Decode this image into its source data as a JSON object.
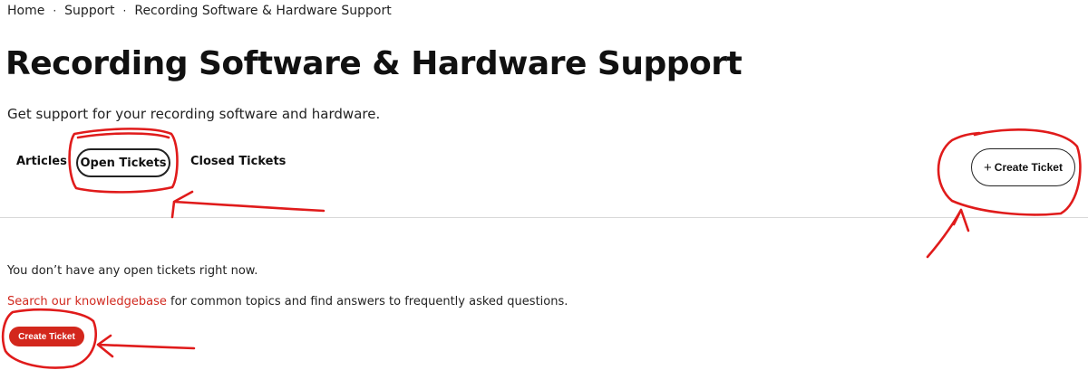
{
  "breadcrumb": {
    "items": [
      "Home",
      "Support",
      "Recording Software & Hardware Support"
    ],
    "separator": "·"
  },
  "page": {
    "title": "Recording Software & Hardware Support",
    "subtitle": "Get support for your recording software and hardware."
  },
  "tabs": [
    {
      "label": "Articles",
      "active": false
    },
    {
      "label": "Open Tickets",
      "active": true
    },
    {
      "label": "Closed Tickets",
      "active": false
    }
  ],
  "actions": {
    "create_ticket_top_label": "Create Ticket",
    "create_ticket_top_icon": "plus-icon",
    "create_ticket_bottom_label": "Create Ticket"
  },
  "content": {
    "empty_message": "You don’t have any open tickets right now.",
    "kb_link_text": "Search our knowledgebase",
    "kb_rest_text": " for common topics and find answers to frequently asked questions."
  },
  "colors": {
    "accent_red": "#d3271c",
    "annotation_red": "#e01b1b",
    "text": "#222222",
    "divider": "#d8d8d8"
  }
}
